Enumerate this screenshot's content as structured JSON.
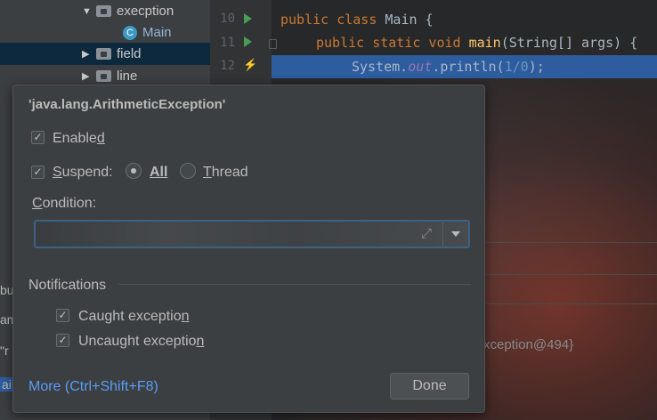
{
  "project_tree": {
    "items": [
      {
        "label": "execption",
        "expanded": true
      },
      {
        "label": "Main"
      },
      {
        "label": "field",
        "expanded": false
      },
      {
        "label": "line",
        "expanded": false
      }
    ]
  },
  "editor": {
    "line_numbers": [
      "10",
      "11",
      "12"
    ],
    "lines": [
      {
        "kw": "public class",
        "name": "Main",
        "rest": " {"
      },
      {
        "kw": "public static void",
        "name": "main",
        "rest": "(String[] args) {"
      },
      {
        "obj": "System.",
        "field": "out",
        "call": ".println(",
        "num": "1/0",
        "end": ");"
      }
    ],
    "background_text": "xception@494}"
  },
  "left_strip": [
    "bu",
    "am",
    "\"r",
    "ai"
  ],
  "dialog": {
    "title": "'java.lang.ArithmeticException'",
    "enabled": {
      "label_a": "Enable",
      "label_u": "d",
      "checked": true
    },
    "suspend": {
      "label_u": "S",
      "label_b": "uspend:",
      "checked": true
    },
    "suspend_mode": {
      "all_label": "All",
      "thread_label_u": "T",
      "thread_label_b": "hread",
      "selected": "All"
    },
    "condition": {
      "label_u": "C",
      "label_b": "ondition:",
      "value": ""
    },
    "notifications": {
      "heading": "Notifications",
      "caught": {
        "label_a": "Caught exceptio",
        "label_u": "n",
        "checked": true
      },
      "uncaught": {
        "label_a": "Uncaught exceptio",
        "label_u": "n",
        "checked": true
      }
    },
    "more_link": "More (Ctrl+Shift+F8)",
    "done_label": "Done"
  },
  "colors": {
    "accent_link": "#589df6",
    "selection": "#2d5d9f",
    "focus_border": "#3d6185"
  }
}
